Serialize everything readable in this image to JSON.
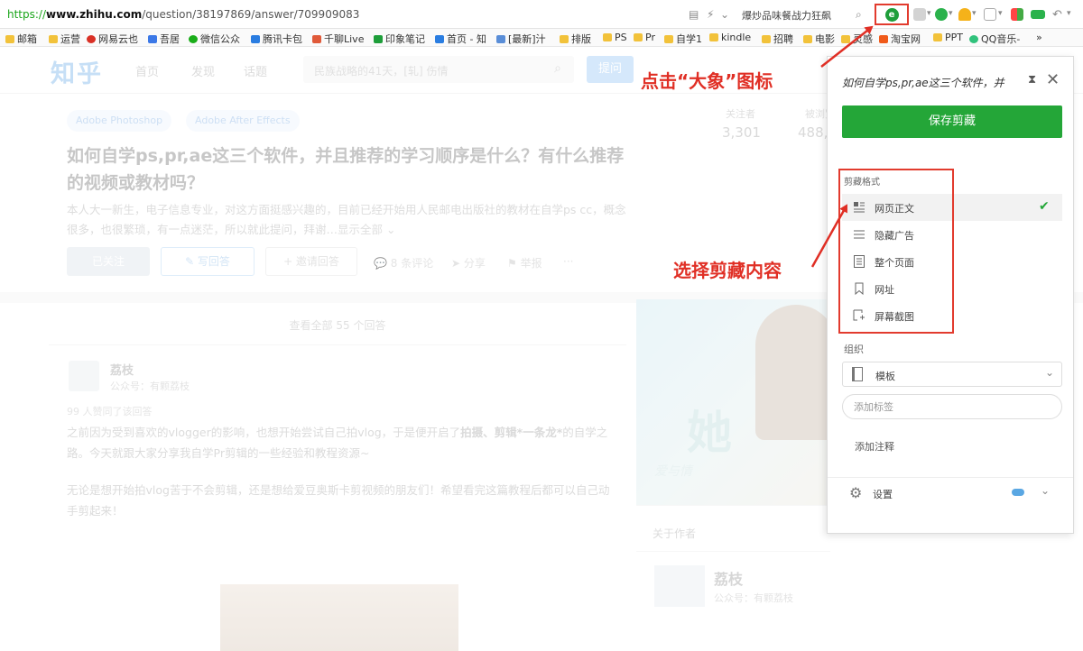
{
  "browser": {
    "url_protocol": "https://",
    "url_host": "www.zhihu.com",
    "url_path": "/question/38197869/answer/709909083",
    "search_hint": "爆炒品味餐战力狂飙",
    "bookmarks": [
      {
        "label": "邮箱",
        "color": "#f2c23a"
      },
      {
        "label": "运营",
        "color": "#f2c23a"
      },
      {
        "label": "网易云也",
        "color": "#d93025"
      },
      {
        "label": "吾居",
        "color": "#3b78e7"
      },
      {
        "label": "微信公众",
        "color": "#1aad19"
      },
      {
        "label": "腾讯卡包",
        "color": "#2a7de1"
      },
      {
        "label": "千聊Live",
        "color": "#e05a3a"
      },
      {
        "label": "印象笔记",
        "color": "#1e9e3a"
      },
      {
        "label": "首页 - 知",
        "color": "#2a7de1"
      },
      {
        "label": "[最新]汁",
        "color": "#5a8ed8"
      },
      {
        "label": "排版",
        "color": "#f2c23a"
      },
      {
        "label": "PS",
        "color": "#f2c23a"
      },
      {
        "label": "Pr",
        "color": "#f2c23a"
      },
      {
        "label": "自学1",
        "color": "#f2c23a"
      },
      {
        "label": "kindle",
        "color": "#f2c23a"
      },
      {
        "label": "招聘",
        "color": "#f2c23a"
      },
      {
        "label": "电影",
        "color": "#f2c23a"
      },
      {
        "label": "灵感",
        "color": "#f2c23a"
      },
      {
        "label": "淘宝网",
        "color": "#f05a1a"
      },
      {
        "label": "PPT",
        "color": "#f2c23a"
      },
      {
        "label": "QQ音乐-",
        "color": "#31c27c"
      }
    ],
    "more_bookmarks": "»"
  },
  "zhihu": {
    "logo": "知乎",
    "nav": [
      "首页",
      "发现",
      "话题"
    ],
    "search_placeholder": "民族战略的41天，[轧] 伤情",
    "ask_button": "提问",
    "topics": [
      "Adobe Photoshop",
      "Adobe After Effects"
    ],
    "stats": [
      {
        "label": "关注者",
        "value": "3,301"
      },
      {
        "label": "被浏览",
        "value": "488,"
      }
    ],
    "question_title": "如何自学ps,pr,ae这三个软件，并且推荐的学习顺序是什么？有什么推荐的视频或教材吗？",
    "question_detail": "本人大一新生，电子信息专业，对这方面挺感兴趣的，目前已经开始用人民邮电出版社的教材在自学ps cc，概念很多，也很繁琐，有一点迷茫，所以就此提问，拜谢…",
    "question_more": "显示全部 ⌄",
    "buttons": {
      "followed": "已关注",
      "write": "✎ 写回答",
      "invite": "+ 邀请回答"
    },
    "actions": [
      "💬 8 条评论",
      "➤ 分享",
      "⚑ 举报",
      "···"
    ],
    "view_all": "查看全部 55 个回答",
    "answer": {
      "author": "荔枝",
      "author_desc": "公众号：有颗荔枝",
      "upvote_note": "99 人赞同了该回答",
      "para1_a": "之前因为受到喜欢的vlogger的影响，也想开始尝试自己拍vlog，于是便开启了",
      "para1_b": "拍摄、剪辑*一条龙*",
      "para1_c": "的自学之路。今天就跟大家分享我自学Pr剪辑的一些经验和教程资源~",
      "para2": "无论是想开始拍vlog苦于不会剪辑，还是想给爱豆奥斯卡剪视频的朋友们！希望看完这篇教程后都可以自己动手剪起来！"
    },
    "side_card": {
      "glyph": "她",
      "caption": "爱与情"
    },
    "about": {
      "title": "关于作者",
      "name": "荔枝",
      "desc": "公众号：有颗荔枝"
    }
  },
  "clipper": {
    "title": "如何自学ps,pr,ae这三个软件，并",
    "pin": "⧗",
    "close": "✕",
    "save_button": "保存剪藏",
    "format_label": "剪藏格式",
    "formats": [
      {
        "label": "网页正文",
        "icon": "article-icon",
        "selected": true
      },
      {
        "label": "隐藏广告",
        "icon": "simplified-icon",
        "selected": false
      },
      {
        "label": "整个页面",
        "icon": "full-page-icon",
        "selected": false
      },
      {
        "label": "网址",
        "icon": "bookmark-icon",
        "selected": false
      },
      {
        "label": "屏幕截图",
        "icon": "screenshot-icon",
        "selected": false
      }
    ],
    "selected_check": "✔",
    "organize_label": "组织",
    "notebook": "模板",
    "tag_placeholder": "添加标签",
    "add_comment": "添加注释",
    "settings_label": "设置",
    "accent": "#24a638"
  },
  "annotations": {
    "click_elephant": "点击“大象”图标",
    "choose_content": "选择剪藏内容",
    "color": "#e02f25"
  }
}
